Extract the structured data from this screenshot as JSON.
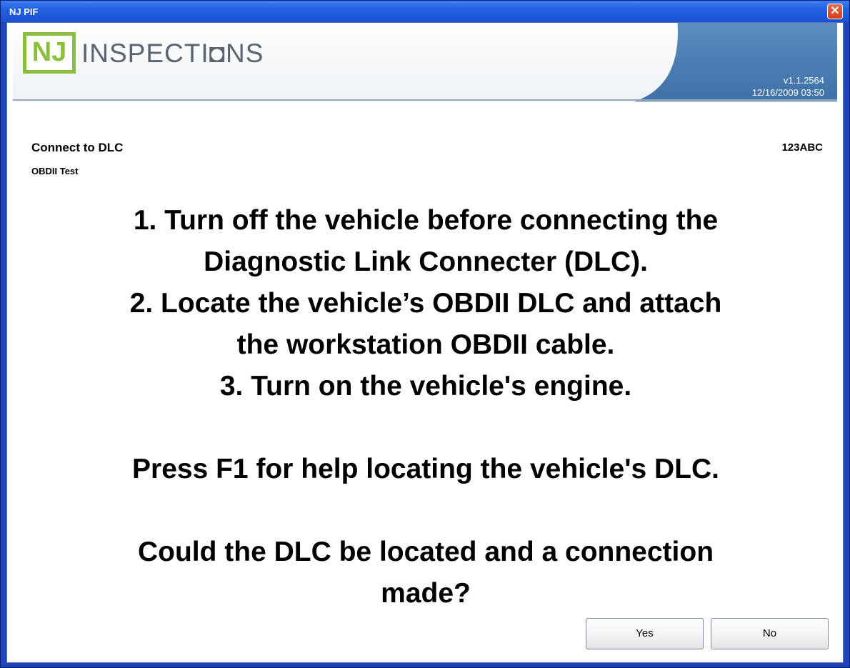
{
  "window": {
    "title": "NJ PIF",
    "close_glyph": "✕"
  },
  "header": {
    "logo_mark": "NJ",
    "logo_wordmark": "INSPECTI◘NS",
    "version": "v1.1.2564",
    "datetime": "12/16/2009 03:50",
    "colors": {
      "logo_green": "#8cc03c",
      "panel_blue": "#4a7fb5",
      "wordmark_gray": "#5b6570"
    }
  },
  "screen": {
    "title": "Connect to DLC",
    "subtitle": "OBDII Test",
    "plate": "123ABC"
  },
  "instructions": {
    "lines": [
      "1. Turn off the vehicle before connecting the",
      "Diagnostic Link Connecter (DLC).",
      "2. Locate the vehicle’s OBDII DLC and attach",
      "the workstation OBDII cable.",
      "3. Turn on the vehicle's engine."
    ],
    "help": "Press F1 for help locating the vehicle's DLC.",
    "question_lines": [
      "Could the DLC be located and a connection",
      "made?"
    ]
  },
  "buttons": {
    "yes": "Yes",
    "no": "No"
  }
}
